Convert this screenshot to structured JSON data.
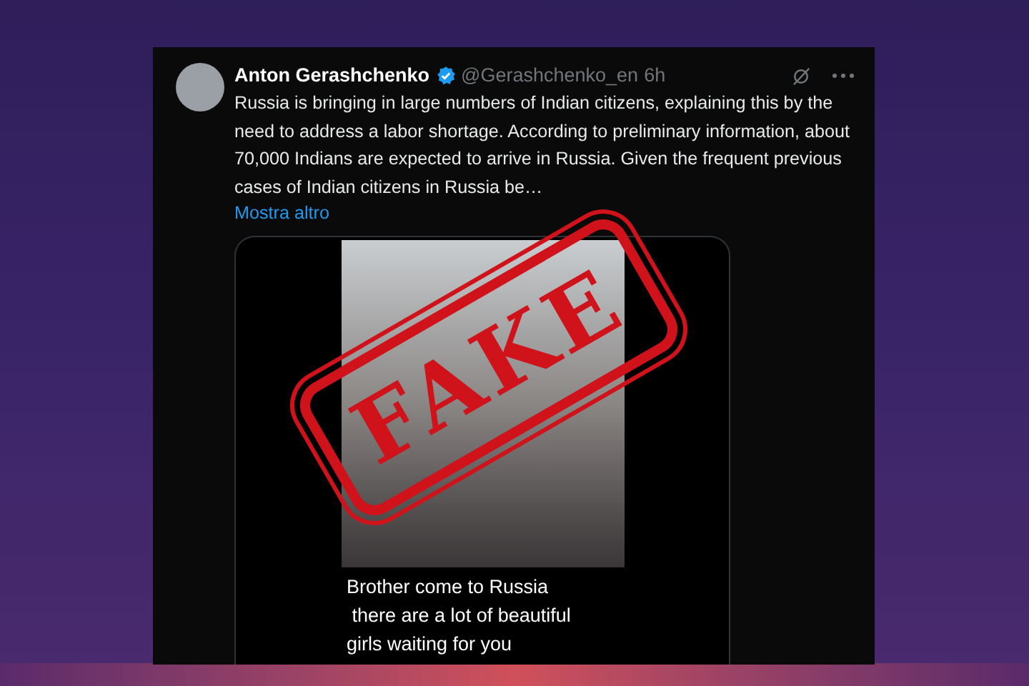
{
  "tweet": {
    "author": "Anton Gerashchenko",
    "verified": true,
    "handle": "@Gerashchenko_en",
    "time": "6h",
    "text": "Russia is bringing in large numbers of Indian citizens, explaining this by the need to address a labor shortage. According to preliminary information, about 70,000 Indians are expected to arrive in Russia. Given the frequent previous cases of Indian citizens in Russia be…",
    "more_link": "Mostra altro"
  },
  "media": {
    "caption": "Brother come to Russia\n there are a lot of beautiful\ngirls waiting for you"
  },
  "stamp": {
    "text": "FAKE"
  }
}
